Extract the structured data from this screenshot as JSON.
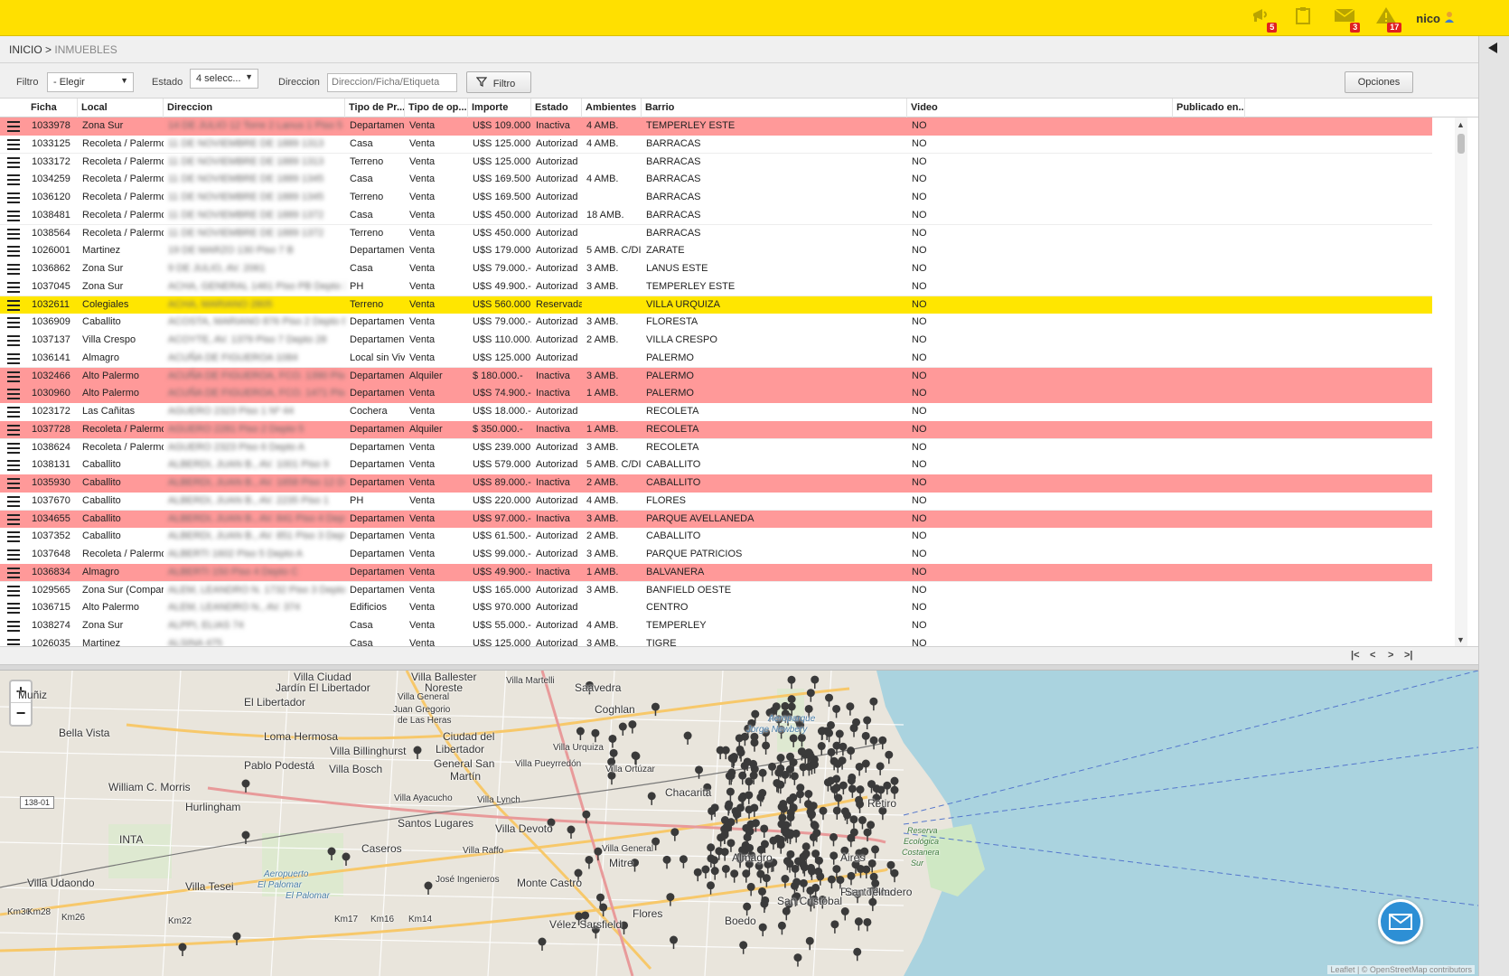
{
  "topbar": {
    "notifications": [
      {
        "icon": "megaphone-icon",
        "count": "5"
      },
      {
        "icon": "note-icon",
        "count": ""
      },
      {
        "icon": "mail-icon",
        "count": "3"
      },
      {
        "icon": "warning-icon",
        "count": "17"
      }
    ],
    "user": "nico"
  },
  "breadcrumb": {
    "home": "INICIO >",
    "current": "INMUEBLES"
  },
  "filters": {
    "filtro_label": "Filtro",
    "filtro_value": "- Elegir",
    "estado_label": "Estado",
    "estado_value": "4 selecc...",
    "direccion_label": "Direccion",
    "direccion_placeholder": "Direccion/Ficha/Etiqueta",
    "filter_button": "Filtro",
    "options_button": "Opciones"
  },
  "grid": {
    "columns": [
      "Ficha",
      "Local",
      "Direccion",
      "Tipo de Pr...",
      "Tipo de op...",
      "Importe",
      "Estado",
      "Ambientes",
      "Barrio",
      "Video",
      "Publicado en..."
    ],
    "rows": [
      {
        "ficha": "1033978",
        "local": "Zona Sur",
        "direccion": "14 DE JULIO 12 Torre 2 Lanus 1 Piso 5 D",
        "tipo": "Departamen",
        "op": "Venta",
        "importe": "U$S 109.000.",
        "estado": "Inactiva",
        "amb": "4 AMB.",
        "barrio": "TEMPERLEY ESTE",
        "video": "NO",
        "status": "inactive"
      },
      {
        "ficha": "1033125",
        "local": "Recoleta / Palermo",
        "direccion": "11 DE NOVIEMBRE DE 1889 1313",
        "tipo": "Casa",
        "op": "Venta",
        "importe": "U$S 125.000.",
        "estado": "Autorizad",
        "amb": "4 AMB.",
        "barrio": "BARRACAS",
        "video": "NO",
        "status": "normal"
      },
      {
        "ficha": "1033172",
        "local": "Recoleta / Palermo",
        "direccion": "11 DE NOVIEMBRE DE 1889 1313",
        "tipo": "Terreno",
        "op": "Venta",
        "importe": "U$S 125.000.",
        "estado": "Autorizad",
        "amb": "",
        "barrio": "BARRACAS",
        "video": "NO",
        "status": "normal"
      },
      {
        "ficha": "1034259",
        "local": "Recoleta / Palermo",
        "direccion": "11 DE NOVIEMBRE DE 1889 1345",
        "tipo": "Casa",
        "op": "Venta",
        "importe": "U$S 169.500.",
        "estado": "Autorizad",
        "amb": "4 AMB.",
        "barrio": "BARRACAS",
        "video": "NO",
        "status": "normal"
      },
      {
        "ficha": "1036120",
        "local": "Recoleta / Palermo",
        "direccion": "11 DE NOVIEMBRE DE 1889 1345",
        "tipo": "Terreno",
        "op": "Venta",
        "importe": "U$S 169.500.",
        "estado": "Autorizad",
        "amb": "",
        "barrio": "BARRACAS",
        "video": "NO",
        "status": "normal"
      },
      {
        "ficha": "1038481",
        "local": "Recoleta / Palermo",
        "direccion": "11 DE NOVIEMBRE DE 1889 1372",
        "tipo": "Casa",
        "op": "Venta",
        "importe": "U$S 450.000.",
        "estado": "Autorizad",
        "amb": "18 AMB.",
        "barrio": "BARRACAS",
        "video": "NO",
        "status": "normal"
      },
      {
        "ficha": "1038564",
        "local": "Recoleta / Palermo",
        "direccion": "11 DE NOVIEMBRE DE 1889 1372",
        "tipo": "Terreno",
        "op": "Venta",
        "importe": "U$S 450.000.",
        "estado": "Autorizad",
        "amb": "",
        "barrio": "BARRACAS",
        "video": "NO",
        "status": "normal"
      },
      {
        "ficha": "1026001",
        "local": "Martinez",
        "direccion": "19 DE MARZO 130 Piso 7 B",
        "tipo": "Departamen",
        "op": "Venta",
        "importe": "U$S 179.000.",
        "estado": "Autorizad",
        "amb": "5 AMB. C/DI",
        "barrio": "ZARATE",
        "video": "NO",
        "status": "normal"
      },
      {
        "ficha": "1036862",
        "local": "Zona Sur",
        "direccion": "9 DE JULIO, AV. 2061",
        "tipo": "Casa",
        "op": "Venta",
        "importe": "U$S 79.000.-",
        "estado": "Autorizad",
        "amb": "3 AMB.",
        "barrio": "LANUS ESTE",
        "video": "NO",
        "status": "normal"
      },
      {
        "ficha": "1037045",
        "local": "Zona Sur",
        "direccion": "ACHA, GENERAL 1461 Piso PB Depto 3",
        "tipo": "PH",
        "op": "Venta",
        "importe": "U$S 49.900.-",
        "estado": "Autorizad",
        "amb": "3 AMB.",
        "barrio": "TEMPERLEY ESTE",
        "video": "NO",
        "status": "normal"
      },
      {
        "ficha": "1032611",
        "local": "Colegiales",
        "direccion": "ACHA, MARIANO 2805",
        "tipo": "Terreno",
        "op": "Venta",
        "importe": "U$S 560.000.",
        "estado": "Reservada",
        "amb": "",
        "barrio": "VILLA URQUIZA",
        "video": "NO",
        "status": "reserved"
      },
      {
        "ficha": "1036909",
        "local": "Caballito",
        "direccion": "ACOSTA, MARIANO 876 Piso 2 Depto 8",
        "tipo": "Departamen",
        "op": "Venta",
        "importe": "U$S 79.000.-",
        "estado": "Autorizad",
        "amb": "3 AMB.",
        "barrio": "FLORESTA",
        "video": "NO",
        "status": "normal"
      },
      {
        "ficha": "1037137",
        "local": "Villa Crespo",
        "direccion": "ACOYTE, AV. 1379 Piso 7 Depto 28",
        "tipo": "Departamen",
        "op": "Venta",
        "importe": "U$S 110.000.",
        "estado": "Autorizad",
        "amb": "2 AMB.",
        "barrio": "VILLA CRESPO",
        "video": "NO",
        "status": "normal"
      },
      {
        "ficha": "1036141",
        "local": "Almagro",
        "direccion": "ACUÑA DE FIGUEROA 1084",
        "tipo": "Local sin Viv",
        "op": "Venta",
        "importe": "U$S 125.000.",
        "estado": "Autorizad",
        "amb": "",
        "barrio": "PALERMO",
        "video": "NO",
        "status": "normal"
      },
      {
        "ficha": "1032466",
        "local": "Alto Palermo",
        "direccion": "ACUÑA DE FIGUEROA, FCO. 1390 Piso 8 C",
        "tipo": "Departamen",
        "op": "Alquiler",
        "importe": "$ 180.000.-",
        "estado": "Inactiva",
        "amb": "3 AMB.",
        "barrio": "PALERMO",
        "video": "NO",
        "status": "inactive"
      },
      {
        "ficha": "1030960",
        "local": "Alto Palermo",
        "direccion": "ACUÑA DE FIGUEROA, FCO. 1471 Piso 6 A",
        "tipo": "Departamen",
        "op": "Venta",
        "importe": "U$S 74.900.-",
        "estado": "Inactiva",
        "amb": "1 AMB.",
        "barrio": "PALERMO",
        "video": "NO",
        "status": "inactive"
      },
      {
        "ficha": "1023172",
        "local": "Las Cañitas",
        "direccion": "AGUERO 2323 Piso 1 Nº 44",
        "tipo": "Cochera",
        "op": "Venta",
        "importe": "U$S 18.000.-",
        "estado": "Autorizad",
        "amb": "",
        "barrio": "RECOLETA",
        "video": "NO",
        "status": "normal"
      },
      {
        "ficha": "1037728",
        "local": "Recoleta / Palermo",
        "direccion": "AGUERO 2281 Piso 2 Depto 5",
        "tipo": "Departamen",
        "op": "Alquiler",
        "importe": "$ 350.000.-",
        "estado": "Inactiva",
        "amb": "1 AMB.",
        "barrio": "RECOLETA",
        "video": "NO",
        "status": "inactive"
      },
      {
        "ficha": "1038624",
        "local": "Recoleta / Palermo",
        "direccion": "AGUERO 2323 Piso 6 Depto A",
        "tipo": "Departamen",
        "op": "Venta",
        "importe": "U$S 239.000.",
        "estado": "Autorizad",
        "amb": "3 AMB.",
        "barrio": "RECOLETA",
        "video": "NO",
        "status": "normal"
      },
      {
        "ficha": "1038131",
        "local": "Caballito",
        "direccion": "ALBERDI, JUAN B., AV. 1001 Piso 9",
        "tipo": "Departamen",
        "op": "Venta",
        "importe": "U$S 579.000.",
        "estado": "Autorizad",
        "amb": "5 AMB. C/DI",
        "barrio": "CABALLITO",
        "video": "NO",
        "status": "normal"
      },
      {
        "ficha": "1035930",
        "local": "Caballito",
        "direccion": "ALBERDI, JUAN B., AV. 1658 Piso 12 Depto",
        "tipo": "Departamen",
        "op": "Venta",
        "importe": "U$S 89.000.-",
        "estado": "Inactiva",
        "amb": "2 AMB.",
        "barrio": "CABALLITO",
        "video": "NO",
        "status": "inactive"
      },
      {
        "ficha": "1037670",
        "local": "Caballito",
        "direccion": "ALBERDI, JUAN B., AV. 2235 Piso 1",
        "tipo": "PH",
        "op": "Venta",
        "importe": "U$S 220.000.",
        "estado": "Autorizad",
        "amb": "4 AMB.",
        "barrio": "FLORES",
        "video": "NO",
        "status": "normal"
      },
      {
        "ficha": "1034655",
        "local": "Caballito",
        "direccion": "ALBERDI, JUAN B., AV. 841 Piso 4 Depto",
        "tipo": "Departamen",
        "op": "Venta",
        "importe": "U$S 97.000.-",
        "estado": "Inactiva",
        "amb": "3 AMB.",
        "barrio": "PARQUE AVELLANEDA",
        "video": "NO",
        "status": "inactive"
      },
      {
        "ficha": "1037352",
        "local": "Caballito",
        "direccion": "ALBERDI, JUAN B., AV. 851 Piso 3 Depto B",
        "tipo": "Departamen",
        "op": "Venta",
        "importe": "U$S 61.500.-",
        "estado": "Autorizad",
        "amb": "2 AMB.",
        "barrio": "CABALLITO",
        "video": "NO",
        "status": "normal"
      },
      {
        "ficha": "1037648",
        "local": "Recoleta / Palermo",
        "direccion": "ALBERTI 1602 Piso 5 Depto A",
        "tipo": "Departamen",
        "op": "Venta",
        "importe": "U$S 99.000.-",
        "estado": "Autorizad",
        "amb": "3 AMB.",
        "barrio": "PARQUE PATRICIOS",
        "video": "NO",
        "status": "normal"
      },
      {
        "ficha": "1036834",
        "local": "Almagro",
        "direccion": "ALBERTI 150 Piso 4 Depto C",
        "tipo": "Departamen",
        "op": "Venta",
        "importe": "U$S 49.900.-",
        "estado": "Inactiva",
        "amb": "1 AMB.",
        "barrio": "BALVANERA",
        "video": "NO",
        "status": "inactive"
      },
      {
        "ficha": "1029565",
        "local": "Zona Sur (Compar",
        "direccion": "ALEM, LEANDRO N. 1732 Piso 3 Depto",
        "tipo": "Departamen",
        "op": "Venta",
        "importe": "U$S 165.000.",
        "estado": "Autorizad",
        "amb": "3 AMB.",
        "barrio": "BANFIELD OESTE",
        "video": "NO",
        "status": "normal"
      },
      {
        "ficha": "1036715",
        "local": "Alto Palermo",
        "direccion": "ALEM, LEANDRO N., AV. 374",
        "tipo": "Edificios",
        "op": "Venta",
        "importe": "U$S 970.000.",
        "estado": "Autorizad",
        "amb": "",
        "barrio": "CENTRO",
        "video": "NO",
        "status": "normal"
      },
      {
        "ficha": "1038274",
        "local": "Zona Sur",
        "direccion": "ALPPI, ELIAS 74",
        "tipo": "Casa",
        "op": "Venta",
        "importe": "U$S 55.000.-",
        "estado": "Autorizad",
        "amb": "4 AMB.",
        "barrio": "TEMPERLEY",
        "video": "NO",
        "status": "normal"
      },
      {
        "ficha": "1026035",
        "local": "Martinez",
        "direccion": "ALSINA 475",
        "tipo": "Casa",
        "op": "Venta",
        "importe": "U$S 125.000.",
        "estado": "Autorizad",
        "amb": "3 AMB.",
        "barrio": "TIGRE",
        "video": "NO",
        "status": "normal"
      }
    ]
  },
  "map": {
    "zoom_in": "+",
    "zoom_out": "−",
    "route_badge": "138-01",
    "labels": [
      "Villa Ciudad",
      "Villa Ballester",
      "Jardín El Libertador",
      "Noreste",
      "Villa Martelli",
      "Saavedra",
      "Muñiz",
      "El Libertador",
      "Villa General",
      "Juan Gregorio",
      "de Las Heras",
      "Coghlan",
      "Aeroparque",
      "Jorge Newbery",
      "Bella Vista",
      "Loma Hermosa",
      "Ciudad del",
      "Libertador",
      "Villa Billinghurst",
      "Villa Urquiza",
      "General San",
      "Martín",
      "Pablo Podestá",
      "Villa Bosch",
      "Villa Pueyrredón",
      "Villa Ortúzar",
      "William C. Morris",
      "Chacarita",
      "Hurlingham",
      "Villa Ayacucho",
      "Villa Lynch",
      "Retiro",
      "Santos Lugares",
      "Villa Devoto",
      "Caseros",
      "INTA",
      "Villa Raffo",
      "Villa General",
      "Mitre",
      "Almagro",
      "Aires",
      "Reserva",
      "Ecológica",
      "Costanera",
      "Sur",
      "Villa Udaondo",
      "Aeropuerto",
      "El Palomar",
      "José Ingenieros",
      "Monte Castro",
      "Villa Tesei",
      "El Palomar",
      "Puerto Madero",
      "San Cristóbal",
      "Flores",
      "Vélez Sarsfield",
      "San Telmo",
      "Boedo",
      "Km30",
      "Km28",
      "Km26",
      "Km22",
      "Km17",
      "Km16",
      "Km14"
    ],
    "attribution": "Leaflet | © OpenStreetMap contributors"
  }
}
